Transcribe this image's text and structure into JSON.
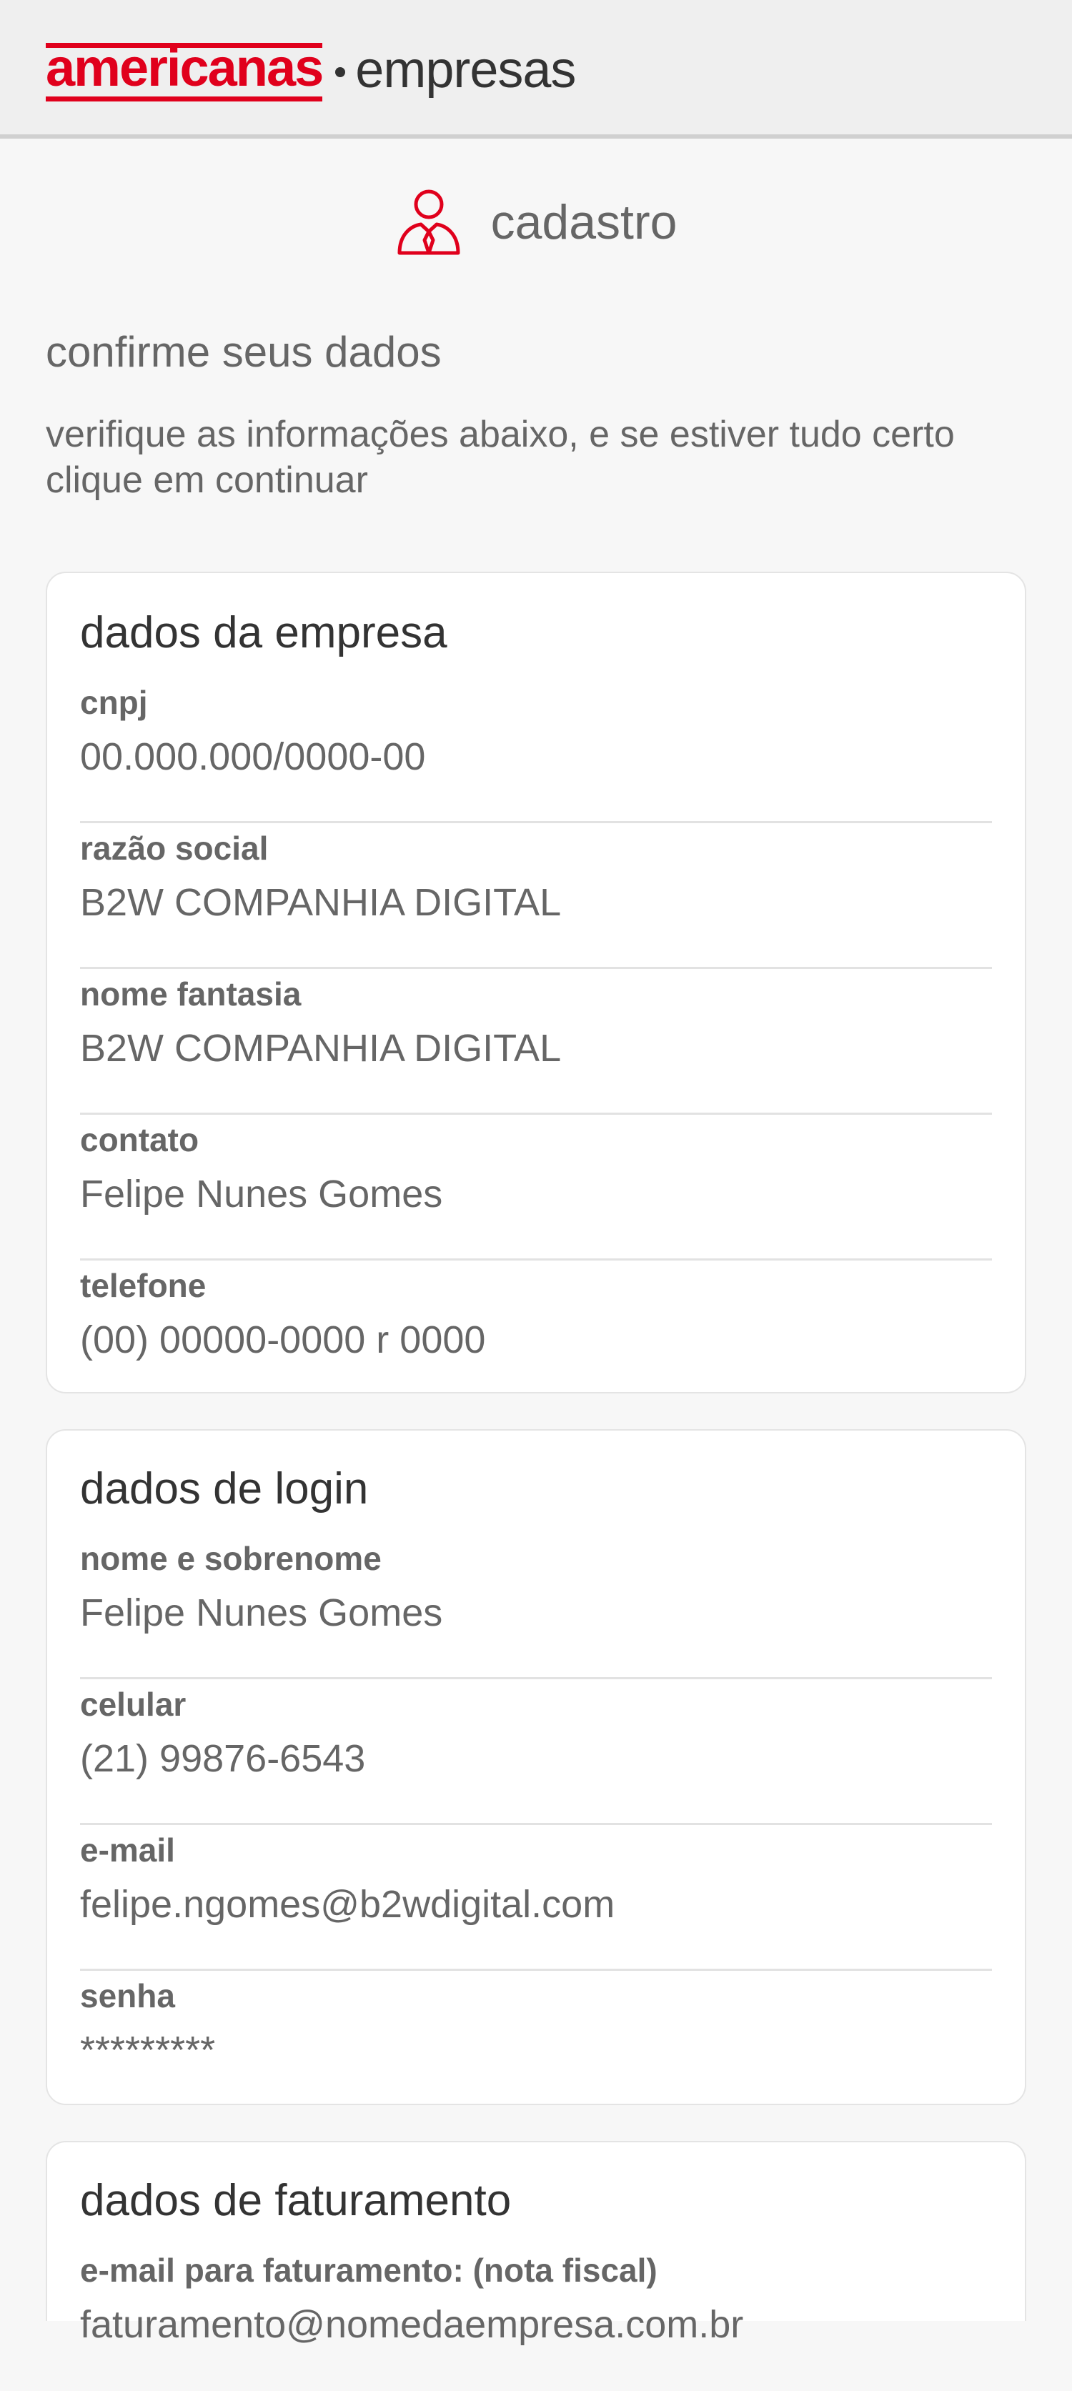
{
  "header": {
    "brand": "americanas",
    "suffix": "empresas"
  },
  "page": {
    "title": "cadastro",
    "icon": "person-tie-icon",
    "section_title": "confirme seus dados",
    "description": "verifique as informações abaixo, e se estiver tudo certo clique em continuar"
  },
  "colors": {
    "brand_red": "#e0001c",
    "text": "#666666",
    "heading": "#333333",
    "background": "#f7f7f7",
    "card": "#ffffff"
  },
  "company": {
    "title": "dados da empresa",
    "fields": [
      {
        "label": "cnpj",
        "value": "00.000.000/0000-00"
      },
      {
        "label": "razão social",
        "value": "B2W COMPANHIA DIGITAL"
      },
      {
        "label": "nome fantasia",
        "value": "B2W COMPANHIA DIGITAL"
      },
      {
        "label": "contato",
        "value": "Felipe Nunes Gomes"
      },
      {
        "label": "telefone",
        "value": "(00) 00000-0000 r 0000"
      }
    ]
  },
  "login": {
    "title": "dados de login",
    "fields": [
      {
        "label": "nome e sobrenome",
        "value": "Felipe Nunes Gomes"
      },
      {
        "label": "celular",
        "value": "(21) 99876-6543"
      },
      {
        "label": "e-mail",
        "value": "felipe.ngomes@b2wdigital.com"
      },
      {
        "label": "senha",
        "value": "*********"
      }
    ]
  },
  "billing": {
    "title": "dados de faturamento",
    "fields": [
      {
        "label": "e-mail para faturamento: (nota fiscal)",
        "value": "faturamento@nomedaempresa.com.br"
      }
    ]
  }
}
